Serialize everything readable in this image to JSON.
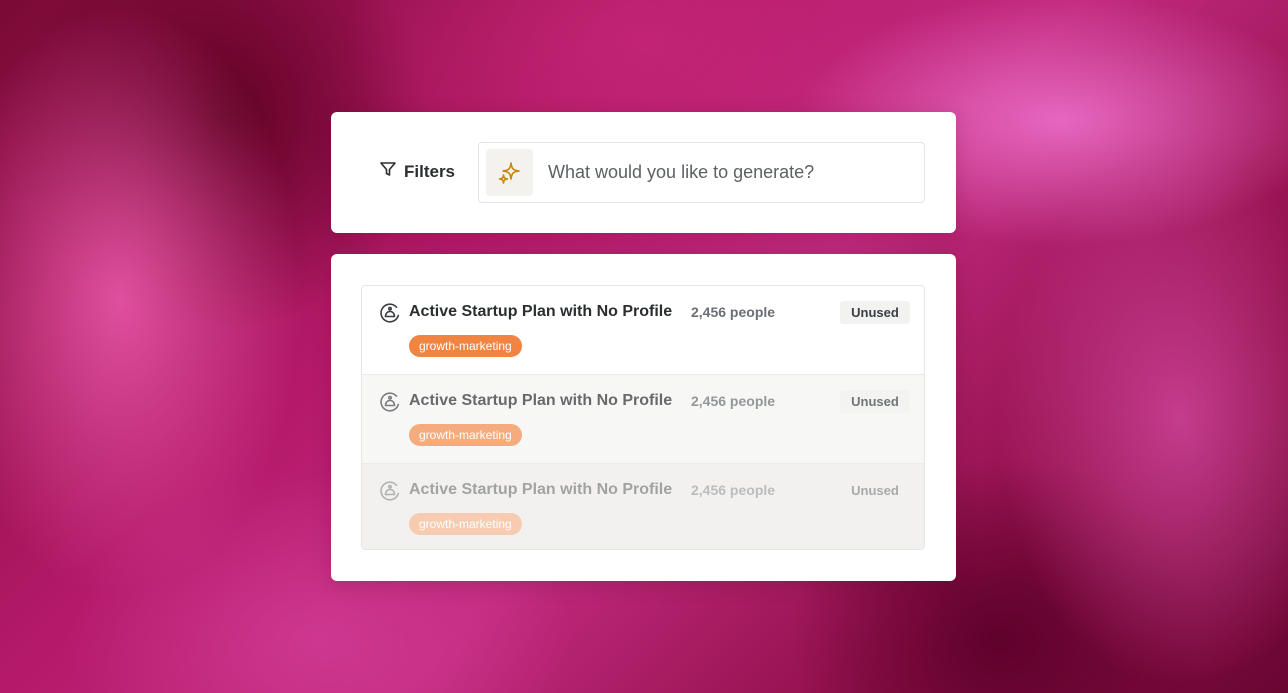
{
  "filters": {
    "label": "Filters",
    "icon": "filter-icon"
  },
  "generate": {
    "placeholder": "What would you like to generate?",
    "icon": "sparkles-icon",
    "icon_color": "#c8860d"
  },
  "segments": [
    {
      "title": "Active Startup Plan with No Profile",
      "count": "2,456 people",
      "status": "Unused",
      "tag": "growth-marketing",
      "tag_color": "#f08440",
      "icon": "segment-icon"
    },
    {
      "title": "Active Startup Plan with No Profile",
      "count": "2,456 people",
      "status": "Unused",
      "tag": "growth-marketing",
      "tag_color": "#f4ab7e",
      "icon": "segment-icon"
    },
    {
      "title": "Active Startup Plan with No Profile",
      "count": "2,456 people",
      "status": "Unused",
      "tag": "growth-marketing",
      "tag_color": "#f6cbb0",
      "icon": "segment-icon"
    }
  ]
}
